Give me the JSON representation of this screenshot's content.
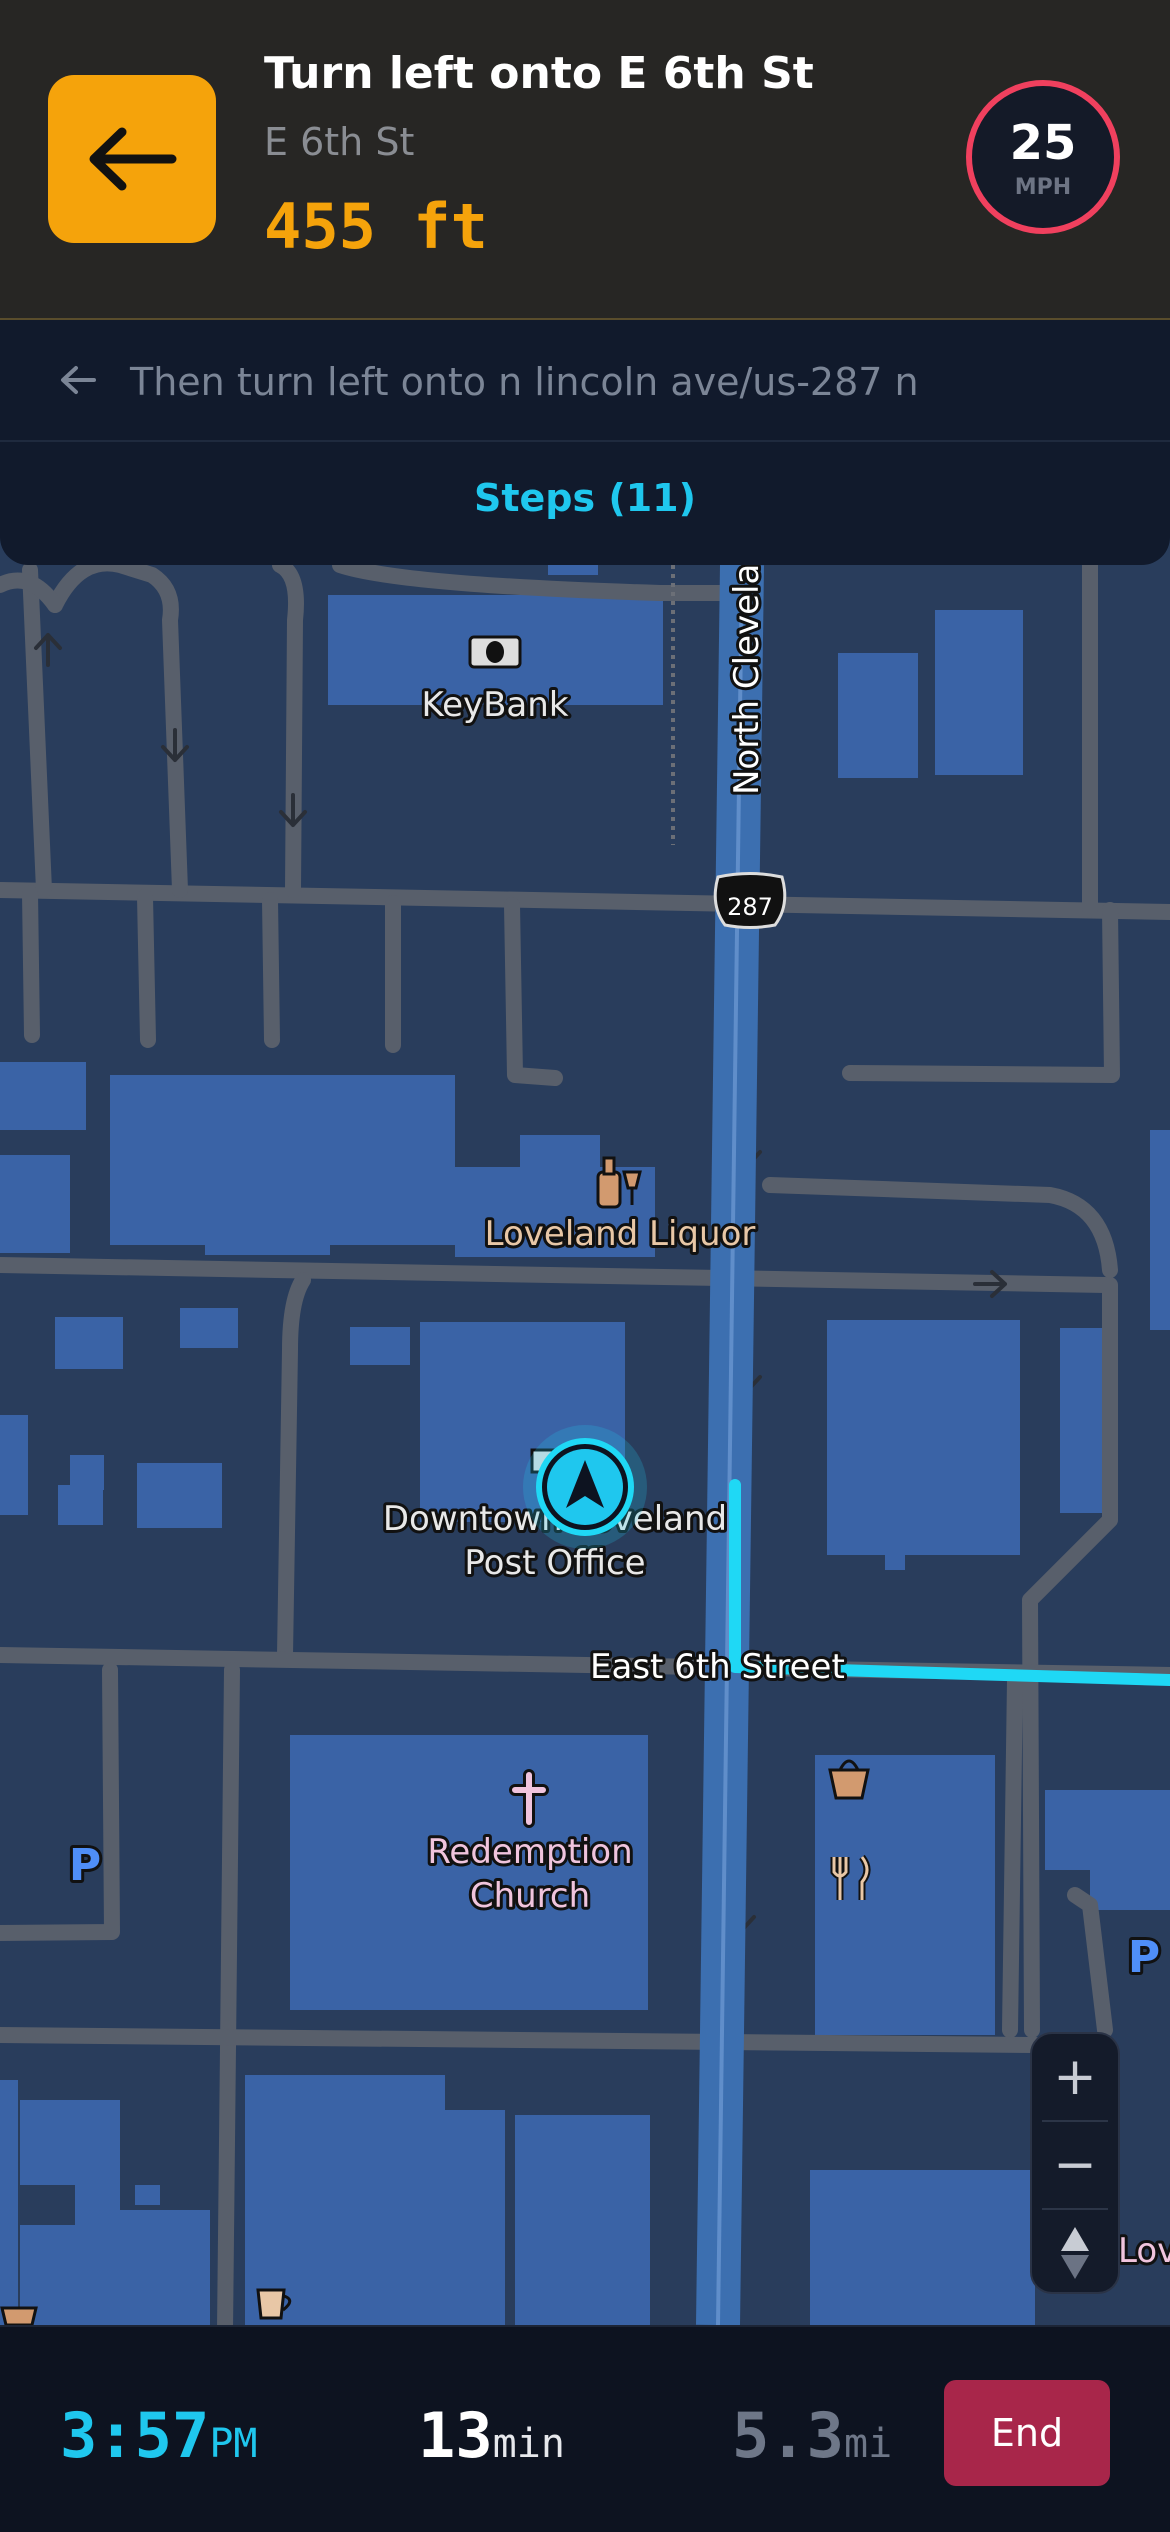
{
  "maneuver": {
    "instruction": "Turn left onto E 6th St",
    "street": "E 6th St",
    "distance": "455 ft",
    "icon": "arrow-left-icon",
    "accent_color": "#f5a30b"
  },
  "speed_limit": {
    "value": "25",
    "unit": "MPH",
    "ring_color": "#f0405e"
  },
  "next_maneuver": {
    "icon": "arrow-left-icon",
    "text": "Then turn left onto n lincoln ave/us-287 n"
  },
  "steps_label": "Steps (11)",
  "map": {
    "pois": {
      "bank": "KeyBank",
      "liquor": "Loveland Liquor",
      "post_office_line1": "Downtown Loveland",
      "post_office_line2": "Post Office",
      "church_line1": "Redemption",
      "church_line2": "Church",
      "edge_label": "Lov"
    },
    "streets": {
      "north_cleveland": "North Clevelan",
      "east_6th": "East 6th Street"
    },
    "route_shield": "287",
    "parking_icon_label": "P",
    "route_color": "#1fd8f5"
  },
  "zoom_controls": {
    "zoom_in": "+",
    "zoom_out": "−"
  },
  "trip": {
    "eta_value": "3:57",
    "eta_unit": "PM",
    "duration_value": "13",
    "duration_unit": "min",
    "distance_value": "5.3",
    "distance_unit": "mi",
    "end_label": "End",
    "end_color": "#a8264a"
  }
}
